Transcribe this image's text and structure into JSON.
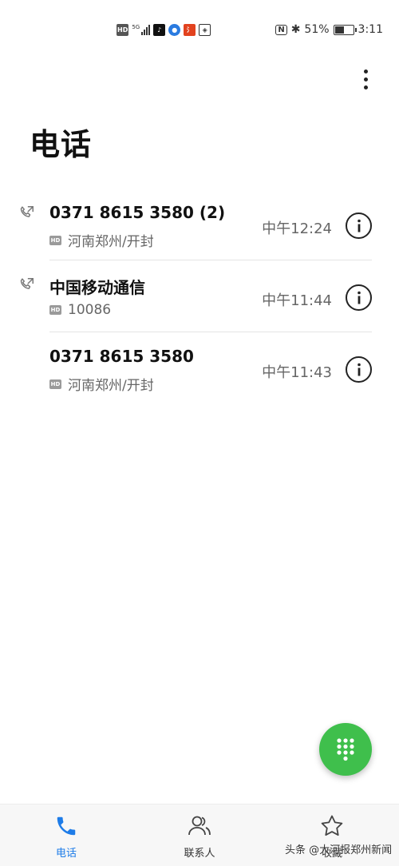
{
  "status_bar": {
    "hd_label": "HD",
    "network_label": "5G",
    "battery_text": "51%",
    "battery_level": 0.51,
    "time": "3:11"
  },
  "header": {
    "title": "电话"
  },
  "calls": [
    {
      "name": "0371 8615 3580 (2)",
      "hd": "HD",
      "subtitle": "河南郑州/开封",
      "time": "中午12:24",
      "type_icon": "outgoing-call-icon"
    },
    {
      "name": "中国移动通信",
      "hd": "HD",
      "subtitle": "10086",
      "time": "中午11:44",
      "type_icon": "outgoing-call-icon"
    },
    {
      "name": "0371 8615 3580",
      "hd": "HD",
      "subtitle": "河南郑州/开封",
      "time": "中午11:43",
      "type_icon": ""
    }
  ],
  "bottom_nav": {
    "items": [
      {
        "label": "电话",
        "icon": "phone-icon",
        "active": true
      },
      {
        "label": "联系人",
        "icon": "contacts-icon",
        "active": false
      },
      {
        "label": "收藏",
        "icon": "star-icon",
        "active": false
      }
    ]
  },
  "watermark": "头条 @大河报郑州新闻",
  "colors": {
    "accent": "#1e7ce8",
    "fab": "#3fbf4c",
    "secondary_text": "#666666"
  }
}
